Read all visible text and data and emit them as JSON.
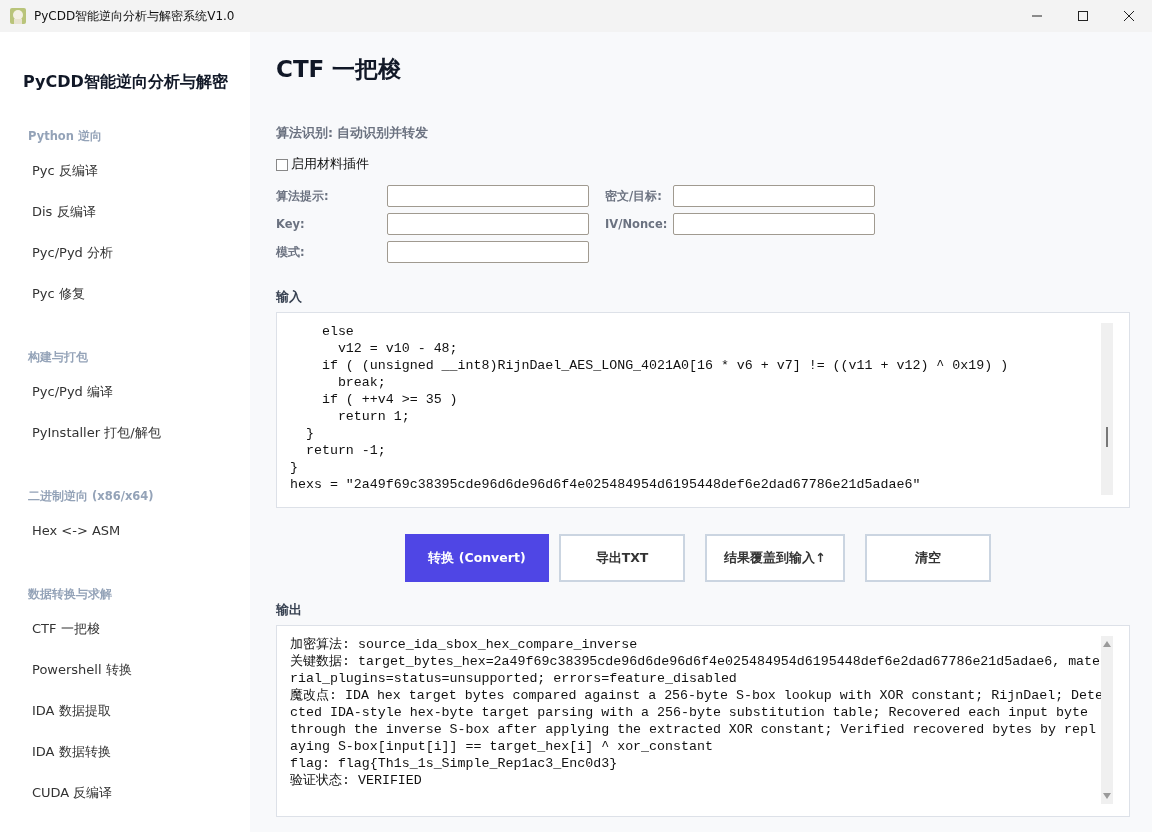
{
  "window": {
    "title": "PyCDD智能逆向分析与解密系统V1.0"
  },
  "sidebar": {
    "title": "PyCDD智能逆向分析与解密",
    "groups": [
      {
        "heading": "Python 逆向",
        "items": [
          "Pyc 反编译",
          "Dis 反编译",
          "Pyc/Pyd 分析",
          "Pyc 修复"
        ]
      },
      {
        "heading": "构建与打包",
        "items": [
          "Pyc/Pyd 编译",
          "PyInstaller 打包/解包"
        ]
      },
      {
        "heading": "二进制逆向 (x86/x64)",
        "items": [
          "Hex <-> ASM"
        ]
      },
      {
        "heading": "数据转换与求解",
        "items": [
          "CTF 一把梭",
          "Powershell 转换",
          "IDA 数据提取",
          "IDA 数据转换",
          "CUDA 反编译"
        ]
      }
    ]
  },
  "page": {
    "title": "CTF 一把梭",
    "algorithm_status": "算法识别: 自动识别并转发",
    "plugin_checkbox": {
      "label": "启用材料插件",
      "checked": false
    },
    "fields": [
      {
        "label": "算法提示:"
      },
      {
        "label": "密文/目标:"
      },
      {
        "label": "Key:"
      },
      {
        "label": "IV/Nonce:"
      },
      {
        "label": "模式:"
      }
    ],
    "input": {
      "label": "输入",
      "lines": [
        "    else",
        "      v12 = v10 - 48;",
        "    if ( (unsigned __int8)RijnDael_AES_LONG_4021A0[16 * v6 + v7] != ((v11 + v12) ^ 0x19) )",
        "      break;",
        "    if ( ++v4 >= 35 )",
        "      return 1;",
        "  }",
        "  return -1;",
        "}",
        "hexs = \"2a49f69c38395cde96d6de96d6f4e025484954d6195448def6e2dad67786e21d5adae6\""
      ]
    },
    "buttons": [
      {
        "label": "转换 (Convert)",
        "kind": "primary"
      },
      {
        "label": "导出TXT",
        "kind": "secondary"
      },
      {
        "label": "结果覆盖到输入↑",
        "kind": "secondary"
      },
      {
        "label": "清空",
        "kind": "secondary"
      }
    ],
    "output": {
      "label": "输出",
      "lines": [
        "加密算法: source_ida_sbox_hex_compare_inverse",
        "关键数据: target_bytes_hex=2a49f69c38395cde96d6de96d6f4e025484954d6195448def6e2dad67786e21d5adae6, material_plugins=status=unsupported; errors=feature_disabled",
        "魔改点: IDA hex target bytes compared against a 256-byte S-box lookup with XOR constant; RijnDael; Detected IDA-style hex-byte target parsing with a 256-byte substitution table; Recovered each input byte through the inverse S-box after applying the extracted XOR constant; Verified recovered bytes by replaying S-box[input[i]] == target_hex[i] ^ xor_constant",
        "flag: flag{Th1s_1s_Simple_Rep1ac3_Enc0d3}",
        "验证状态: VERIFIED"
      ]
    }
  }
}
